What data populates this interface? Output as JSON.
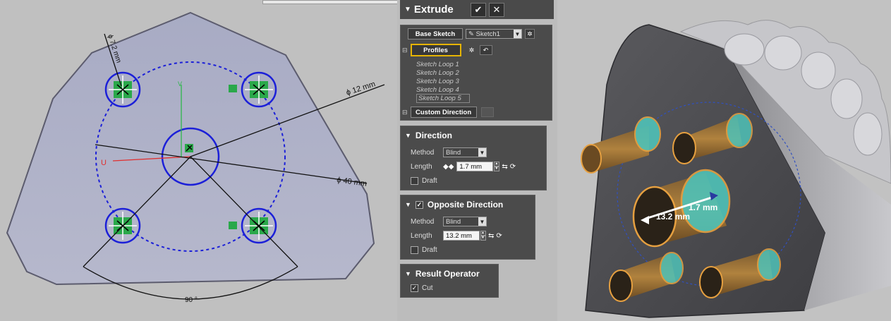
{
  "sketch": {
    "dim_hole": "ϕ 7.2 mm",
    "dim_circle": "ϕ 12 mm",
    "dim_pattern": "ϕ 40 mm",
    "dim_angle": "90 °",
    "axis_u": "U",
    "axis_v": "V"
  },
  "panel": {
    "title": "Extrude",
    "ok": "✔",
    "cancel": "✕",
    "base_sketch_label": "Base Sketch",
    "base_sketch_value": "Sketch1",
    "profiles_label": "Profiles",
    "loops": [
      "Sketch Loop 1",
      "Sketch Loop 2",
      "Sketch Loop 3",
      "Sketch Loop 4",
      "Sketch Loop 5"
    ],
    "custom_direction_label": "Custom Direction",
    "direction": {
      "title": "Direction",
      "method_label": "Method",
      "method_value": "Blind",
      "length_label": "Length",
      "length_value": "1.7 mm",
      "draft_label": "Draft"
    },
    "opposite": {
      "title": "Opposite Direction",
      "method_label": "Method",
      "method_value": "Blind",
      "length_label": "Length",
      "length_value": "13.2 mm",
      "draft_label": "Draft"
    },
    "result": {
      "title": "Result Operator",
      "cut_label": "Cut"
    }
  },
  "view3d": {
    "label_forward": "1.7 mm",
    "label_back": "13.2 mm"
  },
  "colors": {
    "sketch_blue": "#1c20d8",
    "constraint_green": "#2aa84a",
    "cylinder_orange": "#d99a3a",
    "cylinder_teal": "#4fc2b8",
    "panel_bg": "#4b4b4b",
    "highlight_yellow": "#e6b400"
  }
}
